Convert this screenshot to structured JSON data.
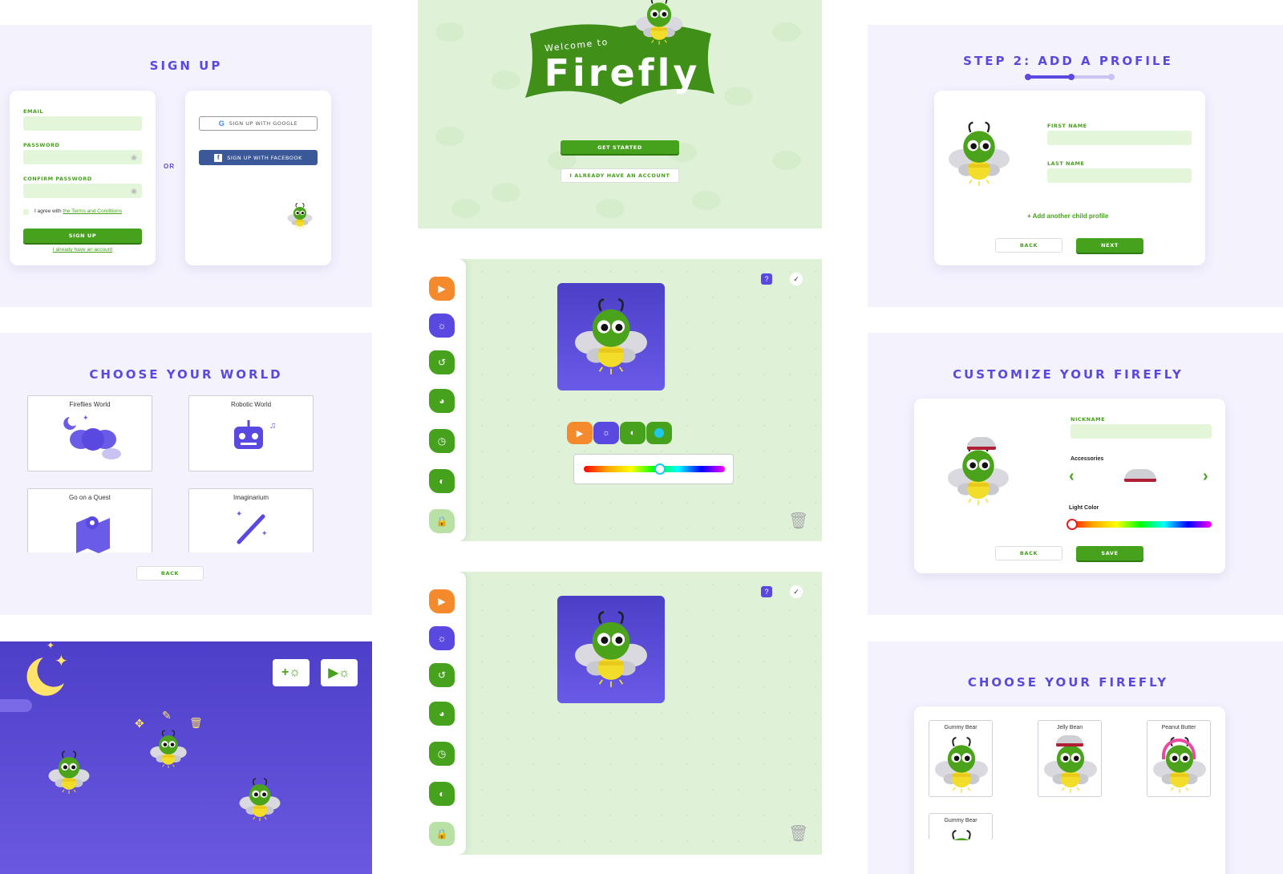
{
  "signup": {
    "title": "SIGN UP",
    "email_label": "EMAIL",
    "password_label": "PASSWORD",
    "confirm_label": "CONFIRM PASSWORD",
    "agree_prefix": "I agree with ",
    "agree_link": "the Terms and Conditions",
    "signup_button": "SIGN UP",
    "have_account": "I already have an account",
    "or": "OR",
    "google_button": "SIGN UP WITH GOOGLE",
    "facebook_button": "SIGN UP WITH FACEBOOK"
  },
  "welcome": {
    "welcome_to": "Welcome to",
    "brand": "Firefly",
    "get_started": "GET STARTED",
    "have_account": "I ALREADY HAVE AN ACCOUNT"
  },
  "profile": {
    "title": "STEP 2: ADD A PROFILE",
    "first_name": "FIRST NAME",
    "last_name": "LAST NAME",
    "add_child": "Add another child profile",
    "back": "BACK",
    "next": "NEXT"
  },
  "world": {
    "title": "CHOOSE YOUR WORLD",
    "cards": [
      {
        "name": "Fireflies World"
      },
      {
        "name": "Robotic World"
      },
      {
        "name": "Go on a Quest"
      },
      {
        "name": "Imaginarium"
      }
    ],
    "back": "BACK"
  },
  "customize": {
    "title": "CUSTOMIZE YOUR FIREFLY",
    "nickname": "NICKNAME",
    "accessories": "Accessories",
    "light_color": "Light Color",
    "back": "BACK",
    "save": "SAVE"
  },
  "choose": {
    "title": "CHOOSE YOUR FIREFLY",
    "fireflies": [
      {
        "name": "Gummy Bear"
      },
      {
        "name": "Jelly Bean"
      },
      {
        "name": "Peanut Butter"
      },
      {
        "name": "Gummy Bear"
      }
    ]
  },
  "colors": {
    "accent": "#5a49e0",
    "green": "#46a11c",
    "lavender": "#f4f2fd",
    "mint": "#dff2d8"
  }
}
